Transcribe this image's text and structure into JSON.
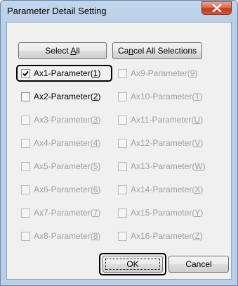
{
  "window": {
    "title": "Parameter Detail Setting",
    "close_glyph": "X"
  },
  "buttons": {
    "select_all": {
      "pre": "Select ",
      "mnemonic": "A",
      "post": "ll"
    },
    "cancel_all": {
      "pre": "Ca",
      "mnemonic": "n",
      "post": "cel All Selections"
    },
    "ok": "OK",
    "cancel": "Cancel"
  },
  "parameters_left": [
    {
      "name": "Ax1-Parameter(",
      "key": "1",
      "close": ")",
      "checked": true,
      "enabled": true
    },
    {
      "name": "Ax2-Parameter(",
      "key": "2",
      "close": ")",
      "checked": false,
      "enabled": true
    },
    {
      "name": "Ax3-Parameter(",
      "key": "3",
      "close": ")",
      "checked": false,
      "enabled": false
    },
    {
      "name": "Ax4-Parameter(",
      "key": "4",
      "close": ")",
      "checked": false,
      "enabled": false
    },
    {
      "name": "Ax5-Parameter(",
      "key": "5",
      "close": ")",
      "checked": false,
      "enabled": false
    },
    {
      "name": "Ax6-Parameter(",
      "key": "6",
      "close": ")",
      "checked": false,
      "enabled": false
    },
    {
      "name": "Ax7-Parameter(",
      "key": "7",
      "close": ")",
      "checked": false,
      "enabled": false
    },
    {
      "name": "Ax8-Parameter(",
      "key": "8",
      "close": ")",
      "checked": false,
      "enabled": false
    }
  ],
  "parameters_right": [
    {
      "name": "Ax9-Parameter(",
      "key": "9",
      "close": ")",
      "checked": false,
      "enabled": false
    },
    {
      "name": "Ax10-Parameter(",
      "key": "T",
      "close": ")",
      "checked": false,
      "enabled": false
    },
    {
      "name": "Ax11-Parameter(",
      "key": "U",
      "close": ")",
      "checked": false,
      "enabled": false
    },
    {
      "name": "Ax12-Parameter(",
      "key": "V",
      "close": ")",
      "checked": false,
      "enabled": false
    },
    {
      "name": "Ax13-Parameter(",
      "key": "W",
      "close": ")",
      "checked": false,
      "enabled": false
    },
    {
      "name": "Ax14-Parameter(",
      "key": "X",
      "close": ")",
      "checked": false,
      "enabled": false
    },
    {
      "name": "Ax15-Parameter(",
      "key": "Y",
      "close": ")",
      "checked": false,
      "enabled": false
    },
    {
      "name": "Ax16-Parameter(",
      "key": "Z",
      "close": ")",
      "checked": false,
      "enabled": false
    }
  ],
  "colors": {
    "enabled_text": "#000000",
    "disabled_text": "#a0a0a0",
    "highlight_outline": "#000000"
  }
}
